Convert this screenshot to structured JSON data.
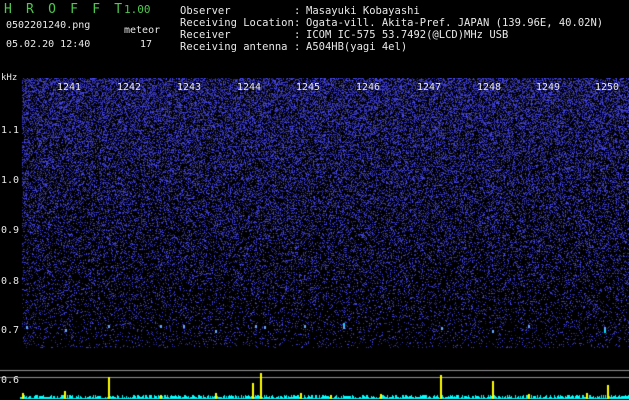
{
  "header": {
    "app_title": "H R O F F T",
    "app_version": "1.00",
    "filename": "0502201240.png",
    "datetime": "05.02.20 12:40",
    "meteor_label": "meteor",
    "meteor_count": "17"
  },
  "info": [
    {
      "label": "Observer",
      "value": "Masayuki Kobayashi"
    },
    {
      "label": "Receiving Location",
      "value": "Ogata-vill. Akita-Pref. JAPAN (139.96E, 40.02N)"
    },
    {
      "label": "Receiver",
      "value": "ICOM IC-575 53.7492(@LCD)MHz USB"
    },
    {
      "label": "Receiving antenna",
      "value": "A504HB(yagi 4el)"
    }
  ],
  "separator": ":",
  "axis": {
    "y_unit": "kHz",
    "y_ticks": [
      "1.1",
      "1.0",
      "0.9",
      "0.8",
      "0.7",
      "0.6"
    ],
    "x_ticks": [
      "1241",
      "1242",
      "1243",
      "1244",
      "1245",
      "1246",
      "1247",
      "1248",
      "1249",
      "1250"
    ]
  },
  "colors": {
    "background": "#000000",
    "header_green": "#4fc84f",
    "noise_dark": "#1a1a8c",
    "noise_bright": "#5a5aff",
    "meteor": "#ffff00",
    "baseline_cyan": "#00ffff"
  }
}
